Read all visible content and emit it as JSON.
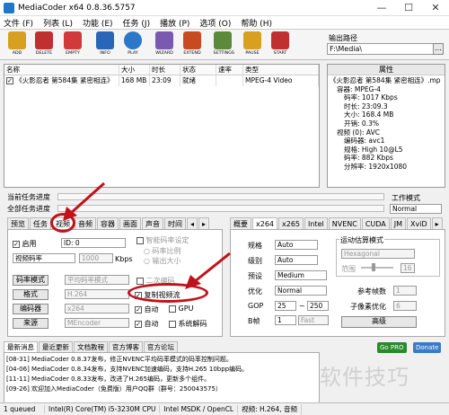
{
  "window": {
    "title": "MediaCoder x64 0.8.36.5757",
    "minimize": "—",
    "maximize": "☐",
    "close": "✕"
  },
  "menu": [
    "文件 (F)",
    "列表 (L)",
    "功能 (E)",
    "任务 (J)",
    "播放 (P)",
    "选项 (O)",
    "帮助 (H)"
  ],
  "toolbar": [
    {
      "label": "ADD",
      "color": "#d8a020"
    },
    {
      "label": "DELETE",
      "color": "#c03030"
    },
    {
      "label": "EMPTY",
      "color": "#d03a3a"
    },
    {
      "label": "INFO",
      "color": "#2a66b8"
    },
    {
      "label": "PLAY",
      "color": "#2c78c8"
    },
    {
      "label": "WIZARD",
      "color": "#7a5ab0"
    },
    {
      "label": "EXTEND",
      "color": "#c84a20"
    },
    {
      "label": "SETTINGS",
      "color": "#5a8a3a"
    },
    {
      "label": "PAUSE",
      "color": "#d8a020"
    },
    {
      "label": "START",
      "color": "#c03030"
    }
  ],
  "output": {
    "label": "输出路径",
    "path": "F:\\Media\\"
  },
  "filelist": {
    "headers": [
      "名称",
      "大小",
      "时长",
      "状态",
      "速率",
      "类型"
    ],
    "rows": [
      {
        "name": "《火影忍者 第584集 紧密相连》",
        "size": "168 MB",
        "duration": "23:09",
        "status": "就绪",
        "rate": "",
        "type": "MPEG-4 Video"
      }
    ]
  },
  "properties": {
    "header": "属性",
    "lines": [
      "《火影忍者 第584集 紧密相连》.mp",
      "容器: MPEG-4",
      "码率: 1017 Kbps",
      "时长: 23:09.3",
      "大小: 168.4 MB",
      "开销: 0.3%",
      "视频 (0): AVC",
      "编码器: avc1",
      "规格: High 10@L5",
      "码率: 882 Kbps",
      "分辨率: 1920x1080"
    ]
  },
  "progress": {
    "current_label": "当前任务进度",
    "overall_label": "全部任务进度",
    "work_mode_label": "工作模式",
    "work_mode_value": "Normal"
  },
  "left_tabs": [
    "预览",
    "任务",
    "视频",
    "音频",
    "容器",
    "画面",
    "声音",
    "时间"
  ],
  "right_tabs": [
    "概要",
    "x264",
    "x265",
    "Intel",
    "NVENC",
    "CUDA",
    "JM",
    "XviD"
  ],
  "video": {
    "enable_label": "启用",
    "enable_checked": "✓",
    "id_value": "ID: 0",
    "mode_value": "视频码率",
    "bitrate_value": "1000",
    "bitrate_unit": "Kbps",
    "smart_rate_label": "智能码率设定",
    "bitrate_ratio_label": "码率比例",
    "output_size_label": "输出大小",
    "rate_mode_button": "码率模式",
    "rate_mode_value": "平均码率模式",
    "two_pass_label": "二次编码",
    "format_button": "格式",
    "format_value": "H.264",
    "copy_stream_label": "复制视频流",
    "copy_stream_checked": "✓",
    "encoder_button": "编码器",
    "encoder_value": "x264",
    "auto_label": "自动",
    "auto_checked": "✓",
    "gpu_label": "GPU",
    "source_button": "来源",
    "source_value": "MEncoder",
    "auto2_label": "自动",
    "auto2_checked": "✓",
    "sysdecode_label": "系统解码"
  },
  "x264": {
    "profile_label": "规格",
    "profile_value": "Auto",
    "level_label": "级别",
    "level_value": "Auto",
    "preset_label": "预设",
    "preset_value": "Medium",
    "tune_label": "优化",
    "tune_value": "Normal",
    "gop_label": "GOP",
    "gop_min": "25",
    "gop_to": "~",
    "gop_max": "250",
    "bframe_label": "B帧",
    "bframe_value": "1",
    "bframe_mode": "Fast",
    "me_group_label": "运动估算模式",
    "me_value": "Hexagonal",
    "range_label": "范围",
    "range_value": "16",
    "ref_label": "参考帧数",
    "ref_value": "1",
    "subpel_label": "子像素优化",
    "subpel_value": "6",
    "advanced_button": "高级"
  },
  "news": {
    "tabs": [
      "最新消息",
      "最近更新",
      "文档教程",
      "官方博客",
      "官方论坛"
    ],
    "items": [
      "[08-31] MediaCoder 0.8.37发布，修正NVENC平均码率模式的码率控制问题。",
      "[04-06] MediaCoder 0.8.34发布，支持NVENC加速编码，支持H.265 10bpp编码。",
      "[11-11] MediaCoder 0.8.33发布，改进了H.265编码，更新多个组件。",
      "[09-26] 欢迎加入MediaCoder（免费版）用户QQ群（群号：250043575）"
    ]
  },
  "badges": {
    "pro": "Go PRO",
    "donate": "Donate"
  },
  "status": [
    "1 queued",
    "Intel(R) Core(TM) i5-3230M CPU",
    "Intel MSDK / OpenCL",
    "视频: H.264, 音频"
  ],
  "watermark": "软件技巧"
}
